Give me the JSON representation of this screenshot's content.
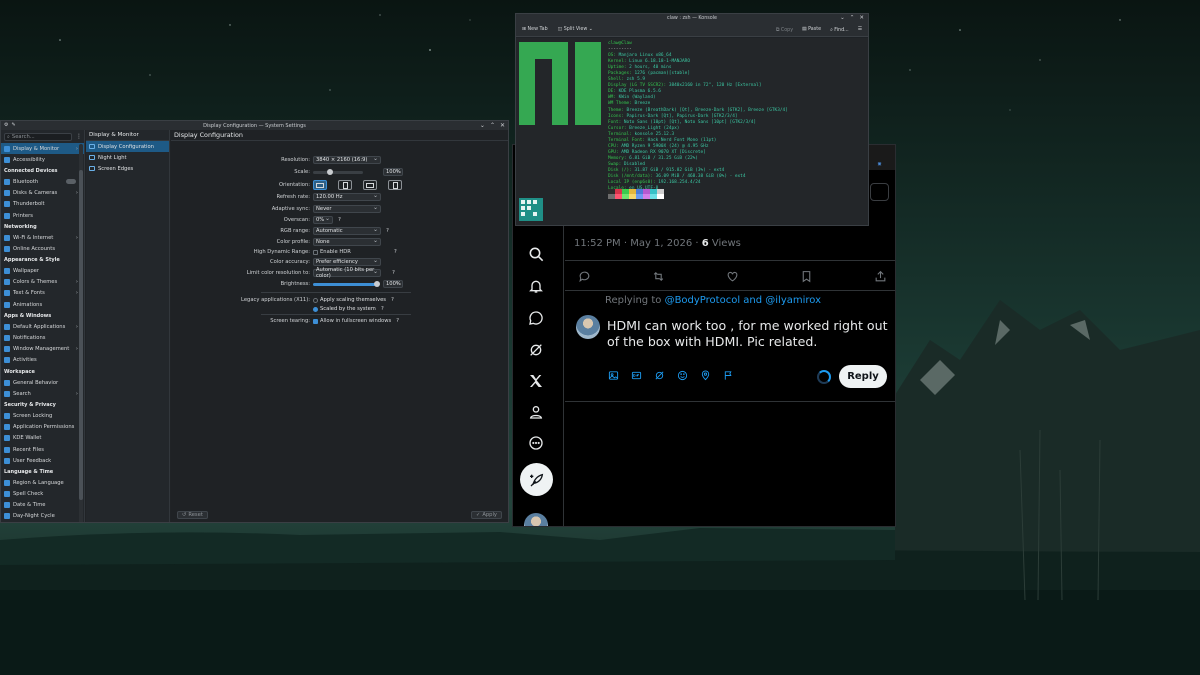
{
  "settings": {
    "title": "Display Configuration — System Settings",
    "search_placeholder": "Search...",
    "sidebar": [
      {
        "label": "Display & Monitor",
        "type": "item",
        "selected": true,
        "arrow": true
      },
      {
        "label": "Accessibility",
        "type": "item"
      },
      {
        "label": "Connected Devices",
        "type": "head"
      },
      {
        "label": "Bluetooth",
        "type": "item",
        "toggle": true
      },
      {
        "label": "Disks & Cameras",
        "type": "item",
        "arrow": true
      },
      {
        "label": "Thunderbolt",
        "type": "item"
      },
      {
        "label": "Printers",
        "type": "item"
      },
      {
        "label": "Networking",
        "type": "head"
      },
      {
        "label": "Wi-Fi & Internet",
        "type": "item",
        "arrow": true
      },
      {
        "label": "Online Accounts",
        "type": "item"
      },
      {
        "label": "Appearance & Style",
        "type": "head"
      },
      {
        "label": "Wallpaper",
        "type": "item"
      },
      {
        "label": "Colors & Themes",
        "type": "item",
        "arrow": true
      },
      {
        "label": "Text & Fonts",
        "type": "item",
        "arrow": true
      },
      {
        "label": "Animations",
        "type": "item"
      },
      {
        "label": "Apps & Windows",
        "type": "head"
      },
      {
        "label": "Default Applications",
        "type": "item",
        "arrow": true
      },
      {
        "label": "Notifications",
        "type": "item"
      },
      {
        "label": "Window Management",
        "type": "item",
        "arrow": true
      },
      {
        "label": "Activities",
        "type": "item"
      },
      {
        "label": "Workspace",
        "type": "head"
      },
      {
        "label": "General Behavior",
        "type": "item"
      },
      {
        "label": "Search",
        "type": "item",
        "arrow": true
      },
      {
        "label": "Security & Privacy",
        "type": "head"
      },
      {
        "label": "Screen Locking",
        "type": "item"
      },
      {
        "label": "Application Permissions",
        "type": "item"
      },
      {
        "label": "KDE Wallet",
        "type": "item"
      },
      {
        "label": "Recent Files",
        "type": "item"
      },
      {
        "label": "User Feedback",
        "type": "item"
      },
      {
        "label": "Language & Time",
        "type": "head"
      },
      {
        "label": "Region & Language",
        "type": "item"
      },
      {
        "label": "Spell Check",
        "type": "item"
      },
      {
        "label": "Date & Time",
        "type": "item"
      },
      {
        "label": "Day-Night Cycle",
        "type": "item"
      }
    ],
    "sub_header": "Display & Monitor",
    "sub_items": [
      {
        "label": "Display Configuration",
        "selected": true
      },
      {
        "label": "Night Light"
      },
      {
        "label": "Screen Edges"
      }
    ],
    "main_header": "Display Configuration",
    "form": {
      "resolution_label": "Resolution:",
      "resolution_value": "3840 × 2160 (16:9)",
      "scale_label": "Scale:",
      "scale_value": "100%",
      "orientation_label": "Orientation:",
      "refresh_label": "Refresh rate:",
      "refresh_value": "120.00 Hz",
      "adaptive_label": "Adaptive sync:",
      "adaptive_value": "Never",
      "overscan_label": "Overscan:",
      "overscan_value": "0%",
      "rgb_label": "RGB range:",
      "rgb_value": "Automatic",
      "profile_label": "Color profile:",
      "profile_value": "None",
      "hdr_label": "High Dynamic Range:",
      "hdr_value": "Enable HDR",
      "accuracy_label": "Color accuracy:",
      "accuracy_value": "Prefer efficiency",
      "linecolor_label": "Limit color resolution to:",
      "linecolor_value": "Automatic (10 bits per color)",
      "brightness_label": "Brightness:",
      "brightness_value": "100%",
      "legacy_label": "Legacy applications (X11):",
      "legacy_opt1": "Apply scaling themselves",
      "legacy_opt2": "Scaled by the system",
      "tearing_label": "Screen tearing:",
      "tearing_value": "Allow in fullscreen windows"
    },
    "reset_label": "Reset",
    "apply_label": "Apply"
  },
  "konsole": {
    "title": "claw : zsh — Konsole",
    "new_tab": "New Tab",
    "split_view": "Split View",
    "copy": "Copy",
    "paste": "Paste",
    "find": "Find...",
    "user": "claw@Claw",
    "sep": "---------",
    "lines": [
      {
        "k": "OS",
        "v": "Manjaro Linux x86_64"
      },
      {
        "k": "Kernel",
        "v": "Linux 6.18.18-1-MANJARO"
      },
      {
        "k": "Uptime",
        "v": "2 hours, 40 mins"
      },
      {
        "k": "Packages",
        "v": "1276 (pacman)[stable]"
      },
      {
        "k": "Shell",
        "v": "zsh 5.9"
      },
      {
        "k": "Display (LG TV SSCR2)",
        "v": "3840x2160 in 72\", 120 Hz [External]"
      },
      {
        "k": "DE",
        "v": "KDE Plasma 6.5.6"
      },
      {
        "k": "WM",
        "v": "KWin (Wayland)"
      },
      {
        "k": "WM Theme",
        "v": "Breeze"
      },
      {
        "k": "Theme",
        "v": "Breeze (BreathDark) [Qt], Breeze-Dark [GTK2], Breeze [GTK3/4]"
      },
      {
        "k": "Icons",
        "v": "Papirus-Dark [Qt], Papirus-Dark [GTK2/3/4]"
      },
      {
        "k": "Font",
        "v": "Noto Sans (10pt) [Qt], Noto Sans [10pt] [GTK2/3/4]"
      },
      {
        "k": "Cursor",
        "v": "Breeze_Light (24px)"
      },
      {
        "k": "Terminal",
        "v": "konsole 25.12.3"
      },
      {
        "k": "Terminal Font",
        "v": "Hack Nerd Font Mono (11pt)"
      },
      {
        "k": "CPU",
        "v": "AMD Ryzen 9 5900X (24) @ 4.95 GHz"
      },
      {
        "k": "GPU",
        "v": "AMD Radeon RX 9070 XT [Discrete]"
      },
      {
        "k": "Memory",
        "v": "6.81 GiB / 31.25 GiB (22%)"
      },
      {
        "k": "Swap",
        "v": "Disabled"
      },
      {
        "k": "Disk (/)",
        "v": "31.87 GiB / 915.82 GiB (3%) - ext4"
      },
      {
        "k": "Disk (/mnt/data)",
        "v": "36.09 MiB / 468.38 GiB (0%) - ext4"
      },
      {
        "k": "Local IP (enp6s0)",
        "v": "192.168.254.4/24"
      },
      {
        "k": "Locale",
        "v": "en_US.UTF-8"
      }
    ],
    "palette1": [
      "#2b2b2b",
      "#d6334a",
      "#3cc94e",
      "#e5b73b",
      "#4b7bd6",
      "#b65ad0",
      "#38c2c8",
      "#cfcfcf"
    ],
    "palette2": [
      "#6d6d6d",
      "#ff5470",
      "#6ee36f",
      "#f7d66a",
      "#6b9bf0",
      "#d47fe8",
      "#6ee0e6",
      "#ffffff"
    ],
    "colors": {
      "logo": "#35a852",
      "key": "#34c24e",
      "value": "#3cc9a4"
    }
  },
  "x": {
    "timestamp": "11:52 PM · May 1, 2026 · ",
    "views_count": "6",
    "views_label": " Views",
    "replying_prefix": "Replying to ",
    "replying_handles": "@BodyProtocol and @ilyamirox",
    "reply_text": "HDMI can work too , for me worked right out of the box with HDMI. Pic related.",
    "reply_button": "Reply",
    "accent": "#1d9bf0"
  }
}
